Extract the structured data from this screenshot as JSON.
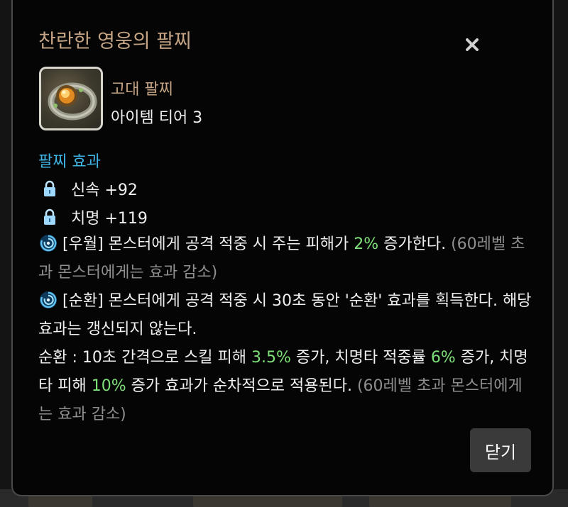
{
  "dialog": {
    "title": "찬란한 영웅의 팔찌",
    "close_icon": "close-icon",
    "item_image": "bracelet-item-image"
  },
  "item": {
    "category": "고대 팔찌",
    "tier": "아이템 티어 3"
  },
  "effects": {
    "section_title": "팔찌 효과",
    "stats": [
      {
        "icon": "lock-icon",
        "label": "신속 +92"
      },
      {
        "icon": "lock-icon",
        "label": "치명 +119"
      }
    ],
    "special": [
      {
        "icon": "swirl-icon",
        "text_before": "[우월] 몬스터에게 공격 적중 시 주는 피해가 ",
        "highlight": "2%",
        "text_after": " 증가한다. ",
        "note": "(60레벨 초과 몬스터에게는 효과 감소)"
      },
      {
        "icon": "swirl-icon",
        "line1": "[순환] 몬스터에게 공격 적중 시 30초 동안 '순환' 효과를 획득한다. 해당 효과는 갱신되지 않는다.",
        "line2_a": "순환 : 10초 간격으로 스킬 피해 ",
        "line2_h1": "3.5%",
        "line2_b": " 증가, 치명타 적중률 ",
        "line2_h2": "6%",
        "line2_c": " 증가, 치명타 피해 ",
        "line2_h3": "10%",
        "line2_d": " 증가 효과가 순차적으로 적용된다. ",
        "note": "(60레벨 초과 몬스터에게는 효과 감소)"
      }
    ]
  },
  "footer": {
    "close_button_label": "닫기"
  },
  "colors": {
    "title": "#c4a484",
    "section": "#3fb6e6",
    "highlight": "#7fe07a",
    "muted": "#8e8e8e"
  }
}
